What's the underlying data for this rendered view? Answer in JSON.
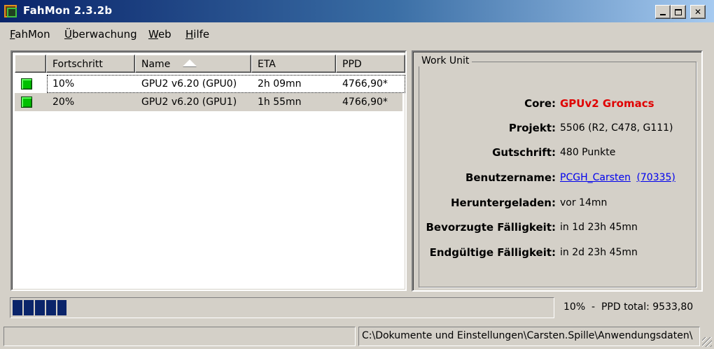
{
  "window": {
    "title": "FahMon 2.3.2b",
    "controls": {
      "minimize": "_",
      "maximize": "□",
      "close": "✕"
    }
  },
  "menu": {
    "items": [
      {
        "label": "FahMon",
        "mnemonic_index": 0
      },
      {
        "label": "Überwachung",
        "mnemonic_index": 0
      },
      {
        "label": "Web",
        "mnemonic_index": 0
      },
      {
        "label": "Hilfe",
        "mnemonic_index": 0
      }
    ]
  },
  "clients_table": {
    "columns": [
      "",
      "Fortschritt",
      "Name",
      "ETA",
      "PPD"
    ],
    "sorted_column": "Name",
    "sort_direction": "ascending",
    "rows": [
      {
        "status": "green",
        "progress": "10%",
        "name": "GPU2 v6.20 (GPU0)",
        "eta": "2h 09mn",
        "ppd": "4766,90*"
      },
      {
        "status": "green",
        "progress": "20%",
        "name": "GPU2 v6.20 (GPU1)",
        "eta": "1h 55mn",
        "ppd": "4766,90*"
      }
    ]
  },
  "work_unit": {
    "legend": "Work Unit",
    "core": {
      "label": "Core:",
      "value": "GPUv2 Gromacs",
      "color": "#e00000"
    },
    "project": {
      "label": "Projekt:",
      "value": "5506 (R2, C478, G111)"
    },
    "credit": {
      "label": "Gutschrift:",
      "value": "480 Punkte"
    },
    "username": {
      "label": "Benutzername:",
      "value": "PCGH_Carsten",
      "team": "(70335)"
    },
    "downloaded": {
      "label": "Heruntergeladen:",
      "value": "vor 14mn"
    },
    "preferred_deadline": {
      "label": "Bevorzugte Fälligkeit:",
      "value": "in 1d 23h 45mn"
    },
    "final_deadline": {
      "label": "Endgültige Fälligkeit:",
      "value": "in 2d 23h 45mn"
    }
  },
  "progress": {
    "fraction": 0.1,
    "text": "10%  -  PPD total: 9533,80"
  },
  "statusbar": {
    "left": "",
    "path": "C:\\Dokumente und Einstellungen\\Carsten.Spille\\Anwendungsdaten\\"
  },
  "colors": {
    "titlebar_start": "#0a246a",
    "titlebar_end": "#a6caf0",
    "face": "#d4d0c8",
    "status_ok": "#00c000",
    "link": "#0000ee",
    "progress": "#0a246a"
  }
}
